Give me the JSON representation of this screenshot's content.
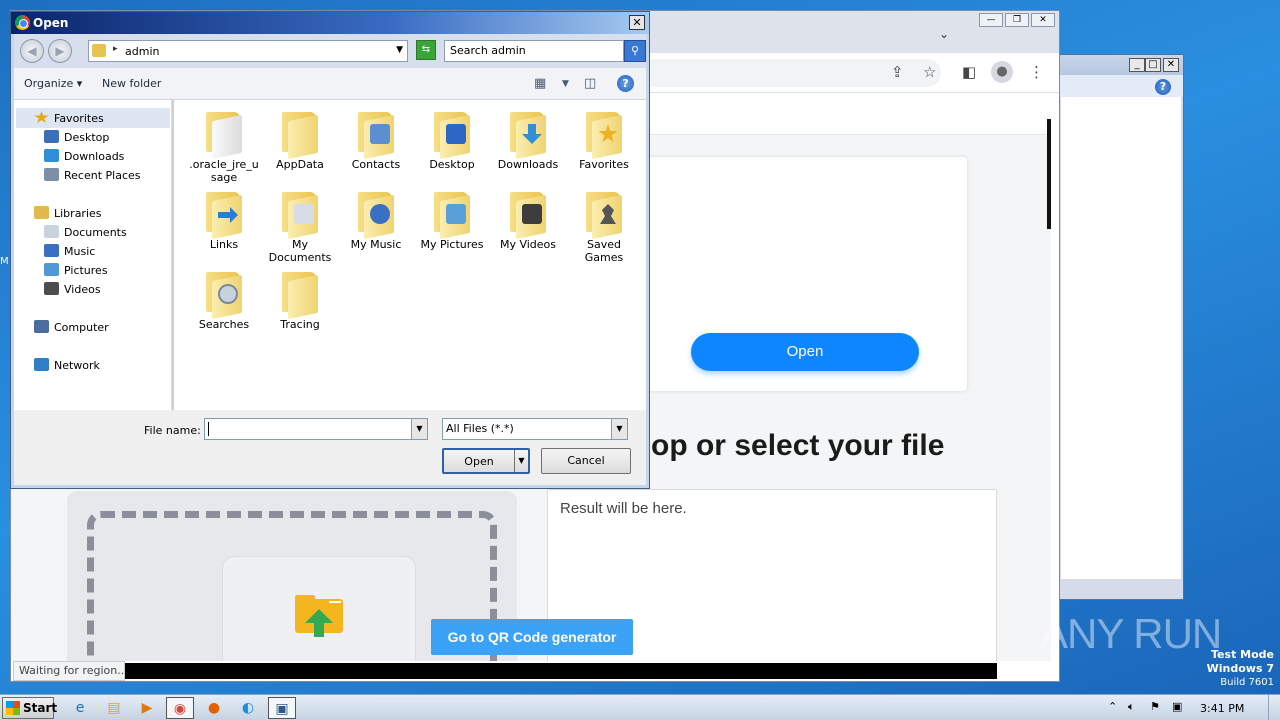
{
  "dialog": {
    "title": "Open",
    "close_glyph": "✕",
    "nav_back_glyph": "◀",
    "nav_fwd_glyph": "▶",
    "path": "admin",
    "search_placeholder": "Search admin",
    "toolbar": {
      "organize": "Organize",
      "new_folder": "New folder"
    },
    "nav_pane": [
      {
        "label": "Favorites",
        "icon": "star-icon",
        "color": "#e8a61a"
      },
      {
        "label": "Desktop",
        "icon": "desktop-icon",
        "color": "#3b6fb8"
      },
      {
        "label": "Downloads",
        "icon": "downloads-icon",
        "color": "#2f8fd8"
      },
      {
        "label": "Recent Places",
        "icon": "recent-places-icon",
        "color": "#7d8fa6"
      },
      {
        "label": "Libraries",
        "icon": "libraries-icon",
        "color": "#e2b94d"
      },
      {
        "label": "Documents",
        "icon": "documents-icon",
        "color": "#c9d3e0"
      },
      {
        "label": "Music",
        "icon": "music-icon",
        "color": "#3a6fc1"
      },
      {
        "label": "Pictures",
        "icon": "pictures-icon",
        "color": "#4f9ad6"
      },
      {
        "label": "Videos",
        "icon": "videos-icon",
        "color": "#4d4d4d"
      },
      {
        "label": "Computer",
        "icon": "computer-icon",
        "color": "#4a6d9e"
      },
      {
        "label": "Network",
        "icon": "network-icon",
        "color": "#2f7ec8"
      }
    ],
    "files": [
      {
        "label": ".oracle_jre_usage",
        "line1": ".oracle_jre_u",
        "line2": "sage",
        "icon": "folder-icon",
        "badge": ""
      },
      {
        "label": "AppData",
        "line1": "AppData",
        "line2": "",
        "icon": "folder-icon",
        "badge": ""
      },
      {
        "label": "Contacts",
        "line1": "Contacts",
        "line2": "",
        "icon": "contacts-folder-icon",
        "badge": "#5b8fd0"
      },
      {
        "label": "Desktop",
        "line1": "Desktop",
        "line2": "",
        "icon": "desktop-folder-icon",
        "badge": "#2d66c4"
      },
      {
        "label": "Downloads",
        "line1": "Downloads",
        "line2": "",
        "icon": "downloads-folder-icon",
        "badge": "#2f8fd8"
      },
      {
        "label": "Favorites",
        "line1": "Favorites",
        "line2": "",
        "icon": "favorites-folder-icon",
        "badge": "#f0b222"
      },
      {
        "label": "Links",
        "line1": "Links",
        "line2": "",
        "icon": "links-folder-icon",
        "badge": "#2a7dd6"
      },
      {
        "label": "My Documents",
        "line1": "My",
        "line2": "Documents",
        "icon": "documents-folder-icon",
        "badge": "#d7dde6"
      },
      {
        "label": "My Music",
        "line1": "My Music",
        "line2": "",
        "icon": "music-folder-icon",
        "badge": "#3b6fc4"
      },
      {
        "label": "My Pictures",
        "line1": "My Pictures",
        "line2": "",
        "icon": "pictures-folder-icon",
        "badge": "#5aa0d8"
      },
      {
        "label": "My Videos",
        "line1": "My Videos",
        "line2": "",
        "icon": "videos-folder-icon",
        "badge": "#3d3d3d"
      },
      {
        "label": "Saved Games",
        "line1": "Saved",
        "line2": "Games",
        "icon": "saved-games-folder-icon",
        "badge": "#555555"
      },
      {
        "label": "Searches",
        "line1": "Searches",
        "line2": "",
        "icon": "searches-folder-icon",
        "badge": "#c7d2de"
      },
      {
        "label": "Tracing",
        "line1": "Tracing",
        "line2": "",
        "icon": "folder-icon",
        "badge": ""
      }
    ],
    "file_name_label": "File name:",
    "file_name_value": "",
    "file_type_value": "All Files (*.*)",
    "open_button": "Open",
    "cancel_button": "Cancel"
  },
  "browser": {
    "status_text": "Waiting for region...",
    "card_open_button": "Open",
    "heading": "op or select your file",
    "result_text": "Result will be here.",
    "qr_button": "Go to QR Code generator"
  },
  "desktop": {
    "test_mode": "Test Mode",
    "os_name": "Windows 7",
    "build": "Build 7601",
    "watermark": "ANY RUN",
    "stray_letter": "M"
  },
  "taskbar": {
    "start_label": "Start",
    "clock": "3:41 PM",
    "apps": [
      {
        "icon": "ie-icon",
        "glyph": "e"
      },
      {
        "icon": "explorer-icon",
        "glyph": "▤"
      },
      {
        "icon": "media-player-icon",
        "glyph": "▶"
      },
      {
        "icon": "chrome-icon",
        "glyph": "◉"
      },
      {
        "icon": "firefox-icon",
        "glyph": "●"
      },
      {
        "icon": "edge-icon",
        "glyph": "◐"
      },
      {
        "icon": "remote-app-icon",
        "glyph": "▣"
      }
    ]
  },
  "colors": {
    "accent": "#0d86ff",
    "qr_button": "#3ca2f5",
    "dialog_title": "#0a246a"
  }
}
